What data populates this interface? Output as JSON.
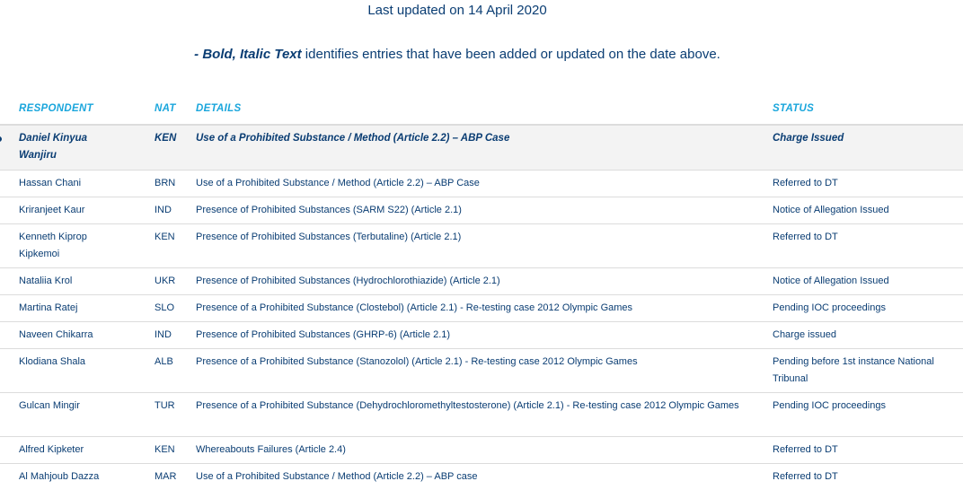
{
  "header": {
    "updated_text": "Last updated on 14 April 2020",
    "legend_bold": "- Bold, Italic Text",
    "legend_rest": " identifies entries that have been added or updated on the date above."
  },
  "table": {
    "columns": {
      "respondent": "RESPONDENT",
      "nat": "NAT",
      "details": "DETAILS",
      "status": "STATUS"
    },
    "rows": [
      {
        "respondent": "Daniel Kinyua Wanjiru",
        "nat": "KEN",
        "details": "Use of a Prohibited Substance / Method (Article 2.2) – ABP Case",
        "status": "Charge Issued",
        "highlight": true
      },
      {
        "respondent": "Hassan Chani",
        "nat": "BRN",
        "details": "Use of a Prohibited Substance / Method (Article 2.2) – ABP Case",
        "status": "Referred to DT"
      },
      {
        "respondent": "Kriranjeet Kaur",
        "nat": "IND",
        "details": "Presence of Prohibited Substances (SARM S22) (Article 2.1)",
        "status": "Notice of Allegation Issued"
      },
      {
        "respondent": "Kenneth Kiprop Kipkemoi",
        "nat": "KEN",
        "details": "Presence of Prohibited Substances (Terbutaline) (Article 2.1)",
        "status": "Referred to DT"
      },
      {
        "respondent": "Nataliia Krol",
        "nat": "UKR",
        "details": "Presence of Prohibited Substances (Hydrochlorothiazide) (Article 2.1)",
        "status": "Notice of Allegation Issued"
      },
      {
        "respondent": "Martina Ratej",
        "nat": "SLO",
        "details": "Presence of a Prohibited Substance (Clostebol) (Article 2.1) - Re-testing case 2012 Olympic Games",
        "status": "Pending IOC proceedings"
      },
      {
        "respondent": "Naveen Chikarra",
        "nat": "IND",
        "details": "Presence of Prohibited Substances (GHRP-6) (Article 2.1)",
        "status": "Charge issued"
      },
      {
        "respondent": "Klodiana Shala",
        "nat": "ALB",
        "details": "Presence of a Prohibited Substance (Stanozolol) (Article 2.1) - Re-testing case 2012 Olympic Games",
        "status": "Pending before 1st instance National Tribunal"
      },
      {
        "respondent": "Gulcan Mingir",
        "nat": "TUR",
        "details": "Presence of a Prohibited Substance (Dehydrochloromethyltestosterone) (Article 2.1) - Re-testing case 2012 Olympic Games",
        "status": "Pending IOC proceedings"
      },
      {
        "respondent": "Alfred Kipketer",
        "nat": "KEN",
        "details": "Whereabouts Failures (Article 2.4)",
        "status": "Referred to DT"
      },
      {
        "respondent": "Al Mahjoub Dazza",
        "nat": "MAR",
        "details": "Use of a Prohibited Substance / Method (Article 2.2) – ABP case",
        "status": "Referred to DT"
      }
    ]
  },
  "colors": {
    "text": "#0a3d73",
    "header_accent": "#1aa6dc",
    "row_highlight": "#f3f3f3",
    "divider": "#dcdcdc"
  }
}
